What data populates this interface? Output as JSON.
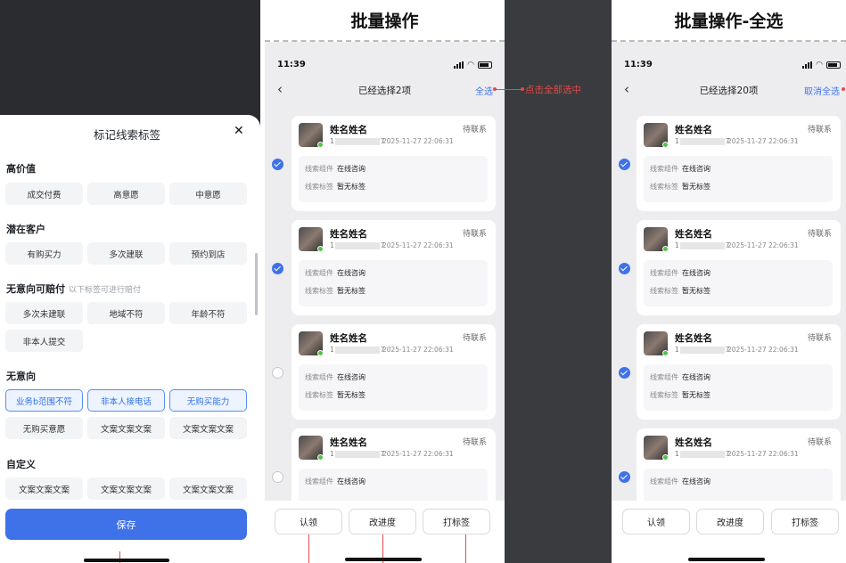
{
  "tag_sheet": {
    "title": "标记线索标签",
    "close_icon": "close-icon",
    "sections": [
      {
        "title": "高价值",
        "subtitle": "",
        "tags": [
          {
            "label": "成交付费",
            "selected": false
          },
          {
            "label": "高意愿",
            "selected": false
          },
          {
            "label": "中意愿",
            "selected": false
          }
        ]
      },
      {
        "title": "潜在客户",
        "subtitle": "",
        "tags": [
          {
            "label": "有购买力",
            "selected": false
          },
          {
            "label": "多次建联",
            "selected": false
          },
          {
            "label": "预约到店",
            "selected": false
          }
        ]
      },
      {
        "title": "无意向可赔付",
        "subtitle": "以下标签可进行赔付",
        "tags": [
          {
            "label": "多次未建联",
            "selected": false
          },
          {
            "label": "地域不符",
            "selected": false
          },
          {
            "label": "年龄不符",
            "selected": false
          },
          {
            "label": "非本人提交",
            "selected": false
          }
        ]
      },
      {
        "title": "无意向",
        "subtitle": "",
        "tags": [
          {
            "label": "业务b范围不符",
            "selected": true
          },
          {
            "label": "非本人接电话",
            "selected": true
          },
          {
            "label": "无购买能力",
            "selected": true
          },
          {
            "label": "无购买意愿",
            "selected": false
          },
          {
            "label": "文案文案文案",
            "selected": false
          },
          {
            "label": "文案文案文案",
            "selected": false
          }
        ]
      },
      {
        "title": "自定义",
        "subtitle": "",
        "tags": [
          {
            "label": "文案文案文案",
            "selected": false
          },
          {
            "label": "文案文案文案",
            "selected": false
          },
          {
            "label": "文案文案文案",
            "selected": false
          }
        ]
      }
    ],
    "save_label": "保存"
  },
  "panels": [
    {
      "banner": "批量操作",
      "time": "11:39",
      "nav_title": "已经选择2项",
      "nav_action": "全选",
      "annotation": "点击全部选中",
      "bottom_buttons": [
        "认领",
        "改进度",
        "打标签"
      ]
    },
    {
      "banner": "批量操作-全选",
      "time": "11:39",
      "nav_title": "已经选择20项",
      "nav_action": "取消全选",
      "bottom_buttons": [
        "认领",
        "改进度",
        "打标签"
      ]
    }
  ],
  "card": {
    "name": "姓名姓名",
    "status": "待联系",
    "phone_start": "1",
    "phone_end": "7",
    "date": "2025-11-27 22:06:31",
    "component_label": "线索组件",
    "component_value": "在线咨询",
    "tag_label": "线索标签",
    "tag_value": "暂无标签"
  },
  "selection": {
    "panel1_checked": [
      true,
      true,
      false,
      false
    ],
    "panel2_checked": [
      true,
      true,
      true,
      true
    ]
  },
  "colors": {
    "accent": "#3f72e9",
    "annotation": "#e04a4a",
    "online": "#52c24a"
  }
}
